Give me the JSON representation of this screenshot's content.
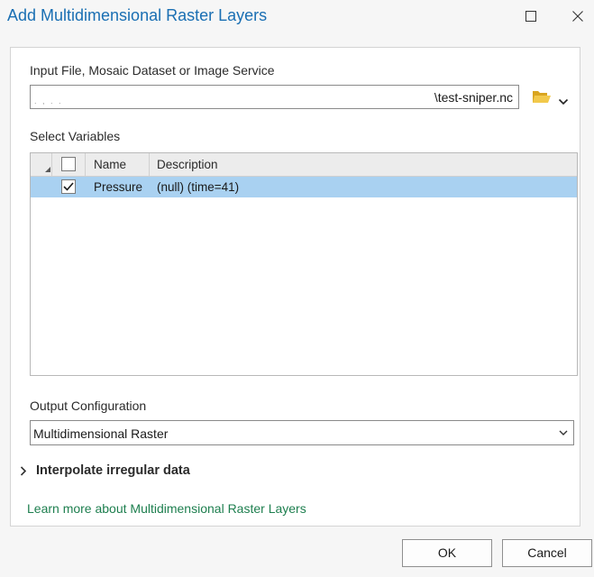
{
  "window": {
    "title": "Add Multidimensional Raster Layers"
  },
  "input": {
    "label": "Input File, Mosaic Dataset or Image Service",
    "value_visible": "\\test-sniper.nc",
    "value_obscured": ". , . ."
  },
  "variables": {
    "label": "Select Variables",
    "columns": [
      "Name",
      "Description"
    ],
    "rows": [
      {
        "name": "Pressure",
        "description": "(null) (time=41)",
        "checked": true,
        "selected": true
      }
    ]
  },
  "output": {
    "label": "Output Configuration",
    "selected": "Multidimensional Raster"
  },
  "interpolate": {
    "label": "Interpolate irregular data"
  },
  "learn_more": {
    "text": "Learn more about Multidimensional Raster Layers"
  },
  "buttons": {
    "ok": "OK",
    "cancel": "Cancel"
  },
  "colors": {
    "title": "#1a6fb3",
    "selected_row": "#a9d1f1",
    "link": "#1e7f4f",
    "folder": "#e6b93a"
  }
}
